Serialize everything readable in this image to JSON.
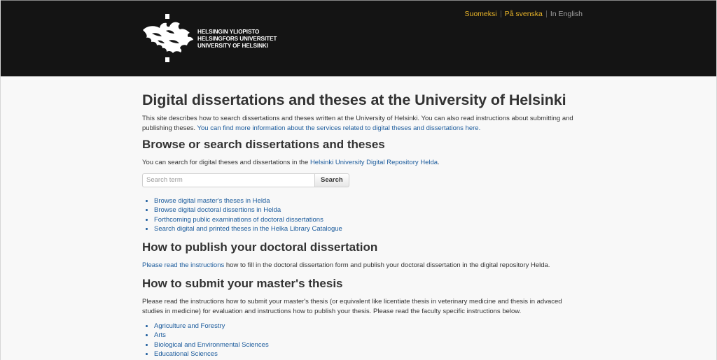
{
  "header": {
    "logo_lines": [
      "HELSINGIN YLIOPISTO",
      "HELSINGFORS UNIVERSITET",
      "UNIVERSITY OF HELSINKI"
    ],
    "languages": [
      {
        "label": "Suomeksi",
        "active": false
      },
      {
        "label": "På svenska",
        "active": false
      },
      {
        "label": "In English",
        "active": true
      }
    ],
    "colors": {
      "background": "#141414",
      "link": "#e8b429",
      "current": "#a0a0a0"
    }
  },
  "main": {
    "title": "Digital dissertations and theses at the University of Helsinki",
    "intro_text": "This site describes how to search dissertations and theses written at the University of Helsinki. You can also read instructions about submitting and publishing theses.",
    "intro_link": "You can find more information about the services related to digital theses and dissertations here.",
    "browse": {
      "heading": "Browse or search dissertations and theses",
      "text_before_link": "You can search for digital theses and dissertations in the",
      "link": "Helsinki University Digital Repository Helda",
      "text_after_link": ".",
      "search_placeholder": "Search term",
      "search_value": "",
      "search_button": "Search",
      "links": [
        "Browse digital master's theses in Helda",
        "Browse digital doctoral dissertions in Helda",
        "Forthcoming public examinations of doctoral dissertations",
        "Search digital and printed theses in the Helka Library Catalogue"
      ]
    },
    "publish": {
      "heading": "How to publish your doctoral dissertation",
      "link": "Please read the instructions",
      "text_after_link": " how to fill in the doctoral dissertation form and publish your doctoral dissertation in the digital repository Helda."
    },
    "submit": {
      "heading": "How to submit your master's thesis",
      "text": "Please read the instructions how to submit your master's thesis (or equivalent like licentiate thesis in veterinary medicine and thesis in advaced studies in medicine) for evaluation and instructions how to publish your thesis. Please read the faculty specific instructions below.",
      "faculties": [
        "Agriculture and Forestry",
        "Arts",
        "Biological and Environmental Sciences",
        "Educational Sciences"
      ]
    }
  },
  "colors": {
    "link": "#1b5b9c",
    "text": "#333333",
    "page_background": "#f8f8f8"
  }
}
